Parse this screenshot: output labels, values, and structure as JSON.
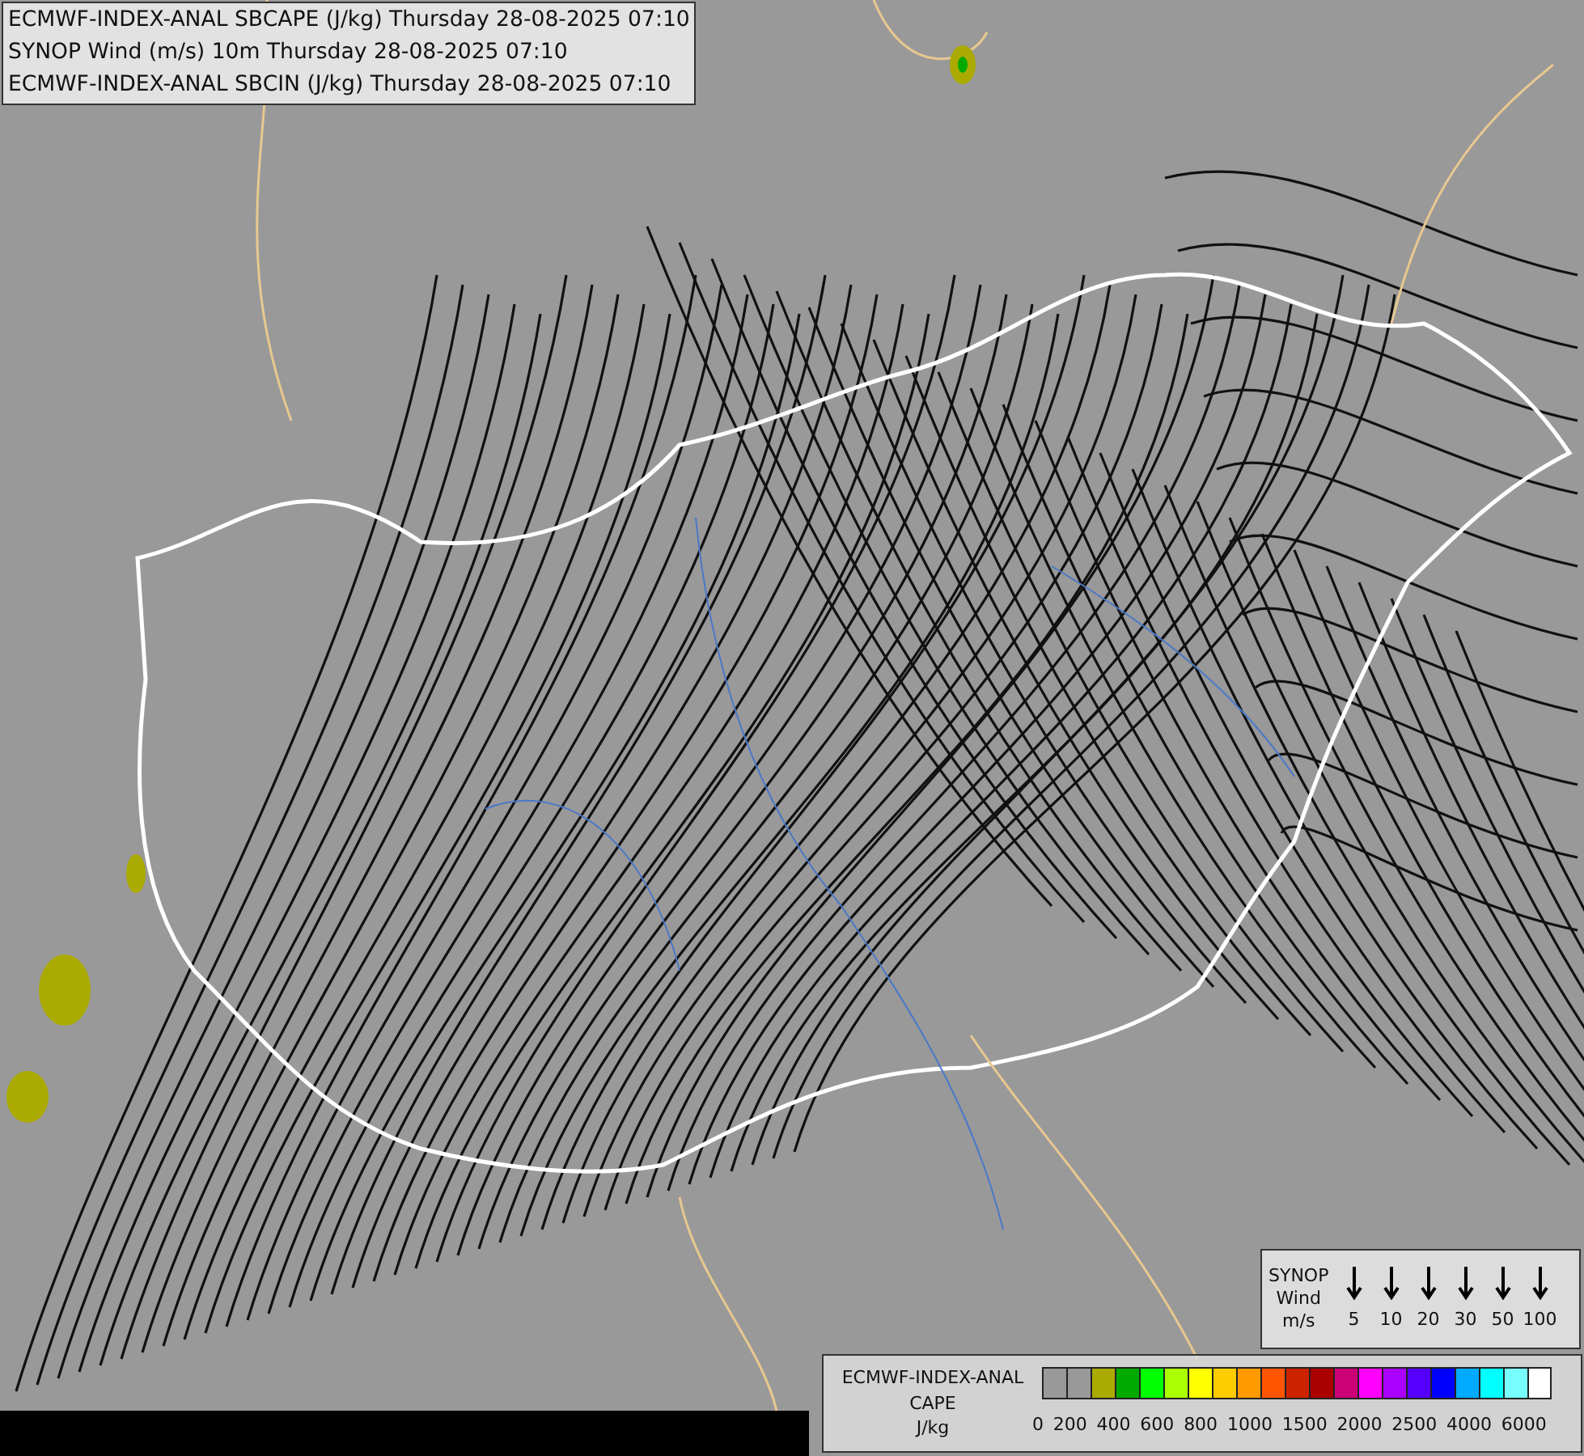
{
  "header": {
    "lines": [
      "ECMWF-INDEX-ANAL SBCAPE (J/kg) Thursday 28-08-2025 07:10",
      "SYNOP Wind (m/s) 10m Thursday 28-08-2025 07:10",
      "ECMWF-INDEX-ANAL SBCIN (J/kg) Thursday 28-08-2025 07:10"
    ]
  },
  "wind_legend": {
    "title_lines": [
      "SYNOP",
      "Wind",
      "m/s"
    ],
    "speeds": [
      "5",
      "10",
      "20",
      "30",
      "50",
      "100"
    ]
  },
  "cape_legend": {
    "title_lines": [
      "ECMWF-INDEX-ANAL",
      "CAPE",
      "J/kg"
    ],
    "swatches": [
      {
        "color": "#999999"
      },
      {
        "color": "#999999"
      },
      {
        "color": "#aaaa00"
      },
      {
        "color": "#00aa00"
      },
      {
        "color": "#00ff00"
      },
      {
        "color": "#aaff00"
      },
      {
        "color": "#ffff00"
      },
      {
        "color": "#ffcc00"
      },
      {
        "color": "#ff9900"
      },
      {
        "color": "#ff5500"
      },
      {
        "color": "#cc2200"
      },
      {
        "color": "#aa0000"
      },
      {
        "color": "#cc0077"
      },
      {
        "color": "#ff00ff"
      },
      {
        "color": "#aa00ff"
      },
      {
        "color": "#5500ff"
      },
      {
        "color": "#0000ff"
      },
      {
        "color": "#00aaff"
      },
      {
        "color": "#00ffff"
      },
      {
        "color": "#77ffff"
      },
      {
        "color": "#ffffff"
      }
    ],
    "tick_labels": [
      "0",
      "200",
      "400",
      "600",
      "800",
      "1000",
      "1500",
      "2000",
      "2500",
      "4000",
      "6000"
    ]
  }
}
